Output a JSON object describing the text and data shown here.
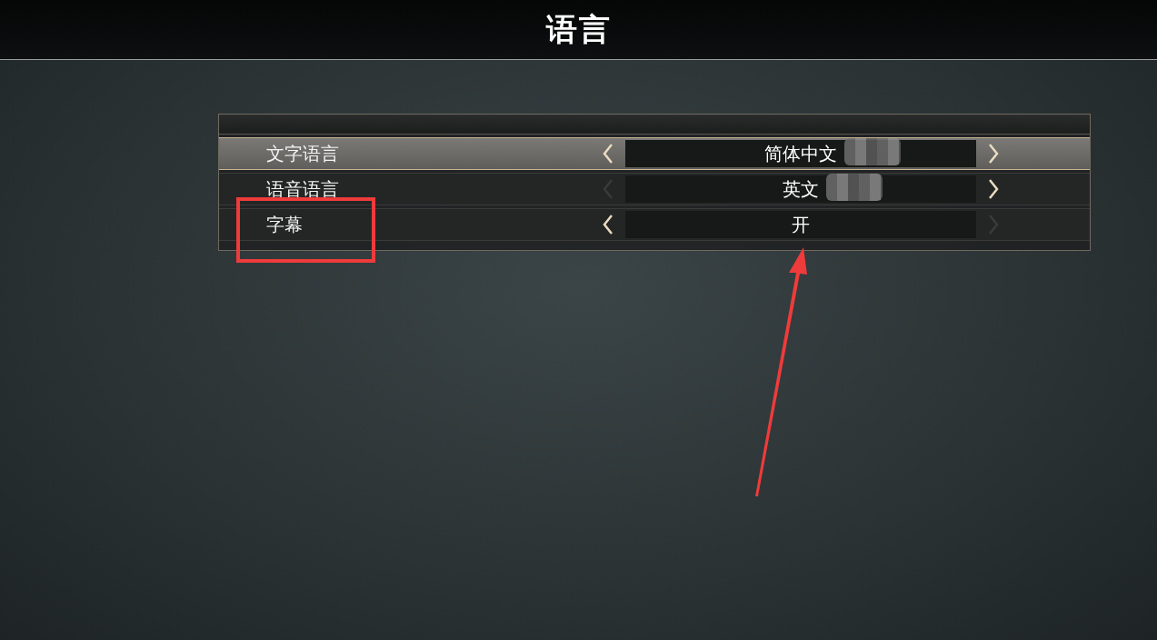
{
  "header": {
    "title": "语言"
  },
  "settings": [
    {
      "label": "文字语言",
      "value": "简体中文",
      "selected": true,
      "prev_enabled": true,
      "next_enabled": true,
      "blurred": true
    },
    {
      "label": "语音语言",
      "value": "英文",
      "selected": false,
      "prev_enabled": false,
      "next_enabled": true,
      "blurred": true
    },
    {
      "label": "字幕",
      "value": "开",
      "selected": false,
      "prev_enabled": true,
      "next_enabled": false,
      "blurred": false
    }
  ],
  "annotations": {
    "highlight_box": true,
    "arrow": true
  }
}
